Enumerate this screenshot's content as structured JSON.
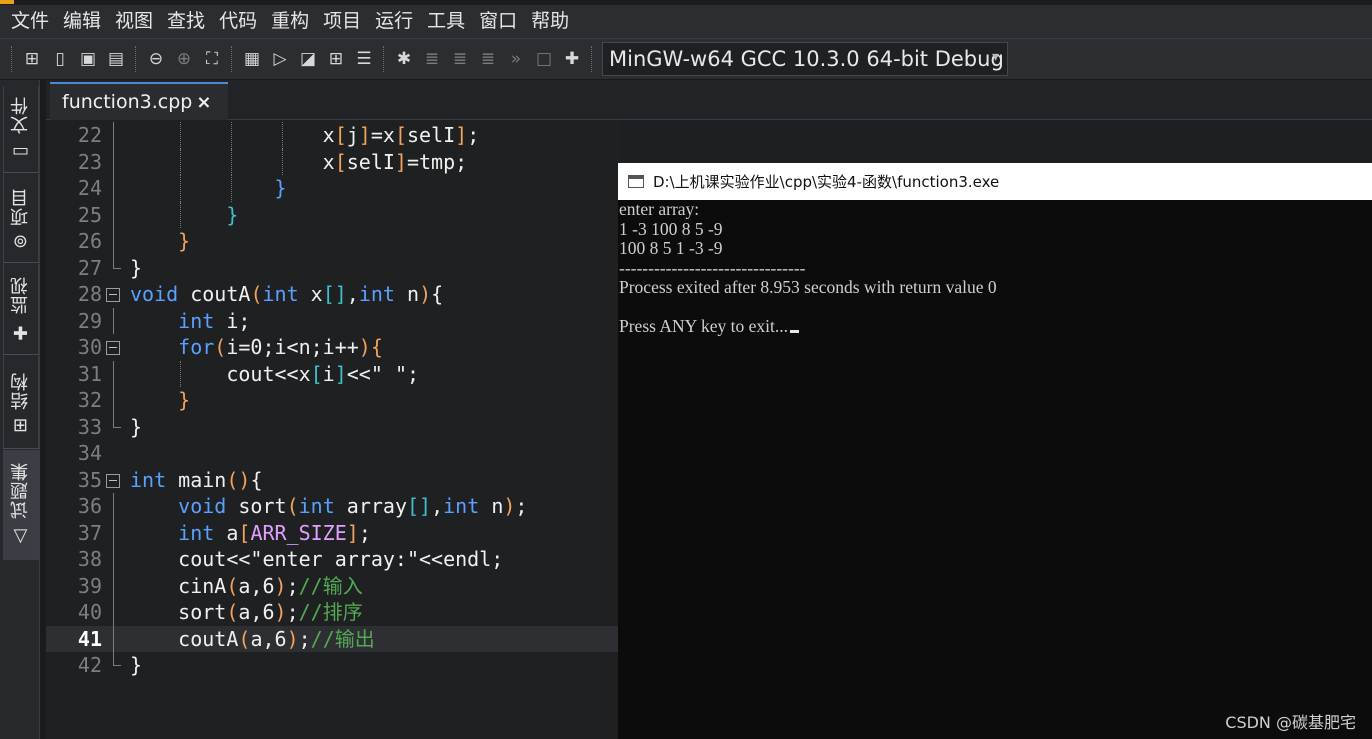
{
  "menubar": {
    "items": [
      "文件",
      "编辑",
      "视图",
      "查找",
      "代码",
      "重构",
      "项目",
      "运行",
      "工具",
      "窗口",
      "帮助"
    ]
  },
  "toolbar": {
    "compiler": "MinGW-w64 GCC 10.3.0 64-bit Debug",
    "icons": [
      "new-file-icon",
      "file-icon",
      "save-icon",
      "save-all-icon",
      "back-icon",
      "forward-icon",
      "fullscreen-icon",
      "compile-icon",
      "run-icon",
      "compile-run-icon",
      "rebuild-icon",
      "options-icon",
      "debug-icon",
      "step-icon",
      "step-into-icon",
      "step-out-icon",
      "continue-icon",
      "stop-icon",
      "add-watch-icon"
    ]
  },
  "sidebar": {
    "tabs": [
      "文件",
      "项目",
      "监视",
      "结构",
      "试题集"
    ]
  },
  "editor": {
    "tab_name": "function3.cpp",
    "tab_close": "×",
    "lines": [
      {
        "n": "22",
        "code": "                x[j]=x[selI];"
      },
      {
        "n": "23",
        "code": "                x[selI]=tmp;"
      },
      {
        "n": "24",
        "code": "            }"
      },
      {
        "n": "25",
        "code": "        }"
      },
      {
        "n": "26",
        "code": "    }"
      },
      {
        "n": "27",
        "code": "}"
      },
      {
        "n": "28",
        "code": "void coutA(int x[],int n){"
      },
      {
        "n": "29",
        "code": "    int i;"
      },
      {
        "n": "30",
        "code": "    for(i=0;i<n;i++){"
      },
      {
        "n": "31",
        "code": "        cout<<x[i]<<\" \";"
      },
      {
        "n": "32",
        "code": "    }"
      },
      {
        "n": "33",
        "code": "}"
      },
      {
        "n": "34",
        "code": ""
      },
      {
        "n": "35",
        "code": "int main(){"
      },
      {
        "n": "36",
        "code": "    void sort(int array[],int n);"
      },
      {
        "n": "37",
        "code": "    int a[ARR_SIZE];"
      },
      {
        "n": "38",
        "code": "    cout<<\"enter array:\"<<endl;"
      },
      {
        "n": "39",
        "code": "    cinA(a,6);//输入"
      },
      {
        "n": "40",
        "code": "    sort(a,6);//排序"
      },
      {
        "n": "41",
        "code": "    coutA(a,6);//输出"
      },
      {
        "n": "42",
        "code": "}"
      }
    ],
    "current_line": "41"
  },
  "console": {
    "title": "D:\\上机课实验作业\\cpp\\实验4-函数\\function3.exe",
    "lines": [
      "enter array:",
      "1 -3 100 8 5 -9",
      "100 8 5 1 -3 -9",
      "--------------------------------",
      "Process exited after 8.953 seconds with return value 0",
      "",
      "Press ANY key to exit..."
    ]
  },
  "watermark": "CSDN @碳基肥宅"
}
